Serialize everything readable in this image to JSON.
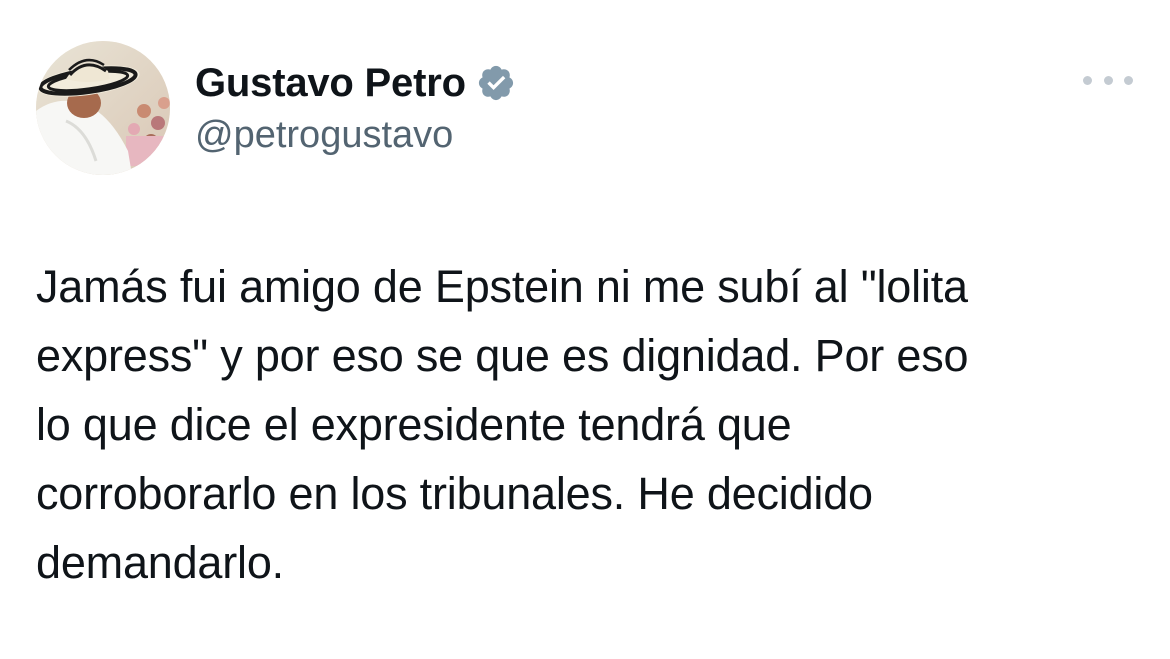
{
  "author": {
    "display_name": "Gustavo Petro",
    "handle": "@petrogustavo",
    "verified": true,
    "verified_color": "#829aab"
  },
  "tweet": {
    "text": "Jamás fui amigo de Epstein ni me subí al \"lolita\nexpress\" y por eso se que es dignidad. Por eso\nlo que dice el expresidente tendrá que\ncorroborarlo en los tribunales. He decidido\ndemandarlo."
  },
  "icons": {
    "more": "more-horizontal-icon",
    "badge": "verified-badge-icon"
  }
}
